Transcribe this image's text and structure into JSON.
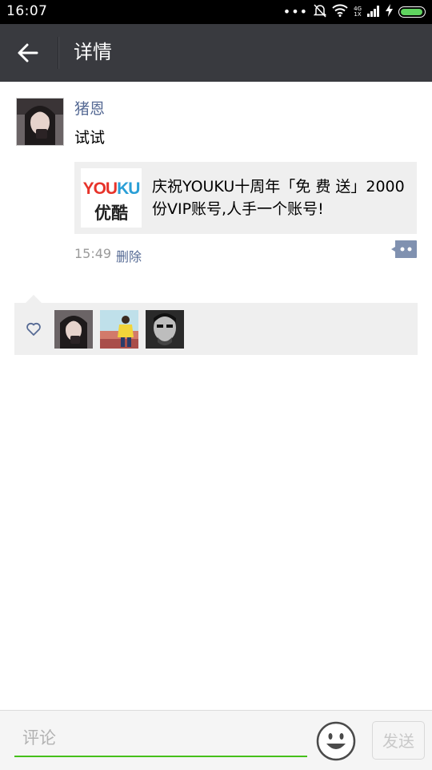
{
  "status_bar": {
    "time": "16:07",
    "network_top": "4G",
    "network_bottom": "1X"
  },
  "header": {
    "title": "详情"
  },
  "post": {
    "username": "猪恩",
    "text": "试试",
    "link_card": {
      "thumb_top_red": "YOU",
      "thumb_top_blue": "KU",
      "thumb_bottom": "优酷",
      "title": "庆祝YOUKU十周年「免 费 送」2000份VIP账号,人手一个账号!"
    },
    "time": "15:49",
    "delete_label": "删除"
  },
  "likes": {
    "count": 3
  },
  "comment_bar": {
    "placeholder": "评论",
    "value": "",
    "send_label": "发送"
  },
  "colors": {
    "title_bar": "#393a3f",
    "link_blue": "#576b95",
    "accent_green": "#45c01a",
    "youku_red": "#e7332a",
    "youku_blue": "#2a9fd6"
  },
  "icons": [
    "back-arrow-icon",
    "heart-icon",
    "more-dots-icon",
    "emoji-icon",
    "wifi-icon",
    "mute-bell-icon",
    "signal-icon",
    "battery-icon"
  ]
}
